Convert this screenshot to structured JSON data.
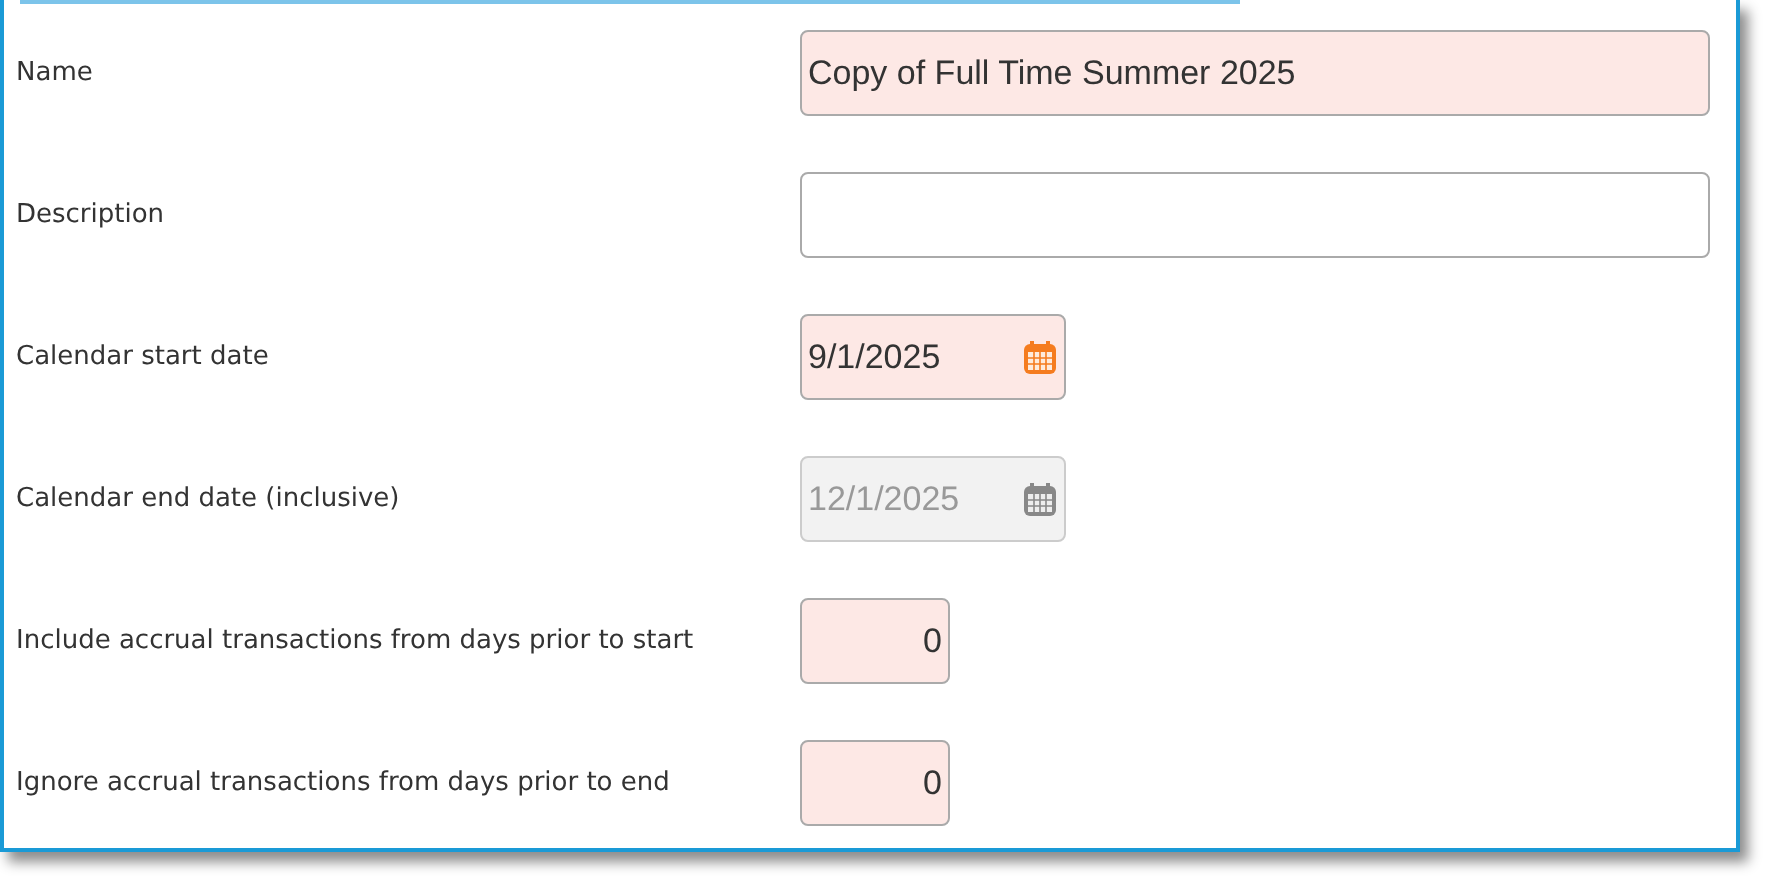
{
  "fields": [
    {
      "label": "Name",
      "kind": "text",
      "value": "Copy of Full Time Summer 2025",
      "required": true,
      "disabled": false
    },
    {
      "label": "Description",
      "kind": "text",
      "required": false,
      "disabled": false
    },
    {
      "label": "Calendar start date",
      "kind": "date",
      "value": "9/1/2025",
      "required": true,
      "disabled": false
    },
    {
      "label": "Calendar end date (inclusive)",
      "kind": "date",
      "value": "12/1/2025",
      "disabled": true
    },
    {
      "label": "Include accrual transactions from days prior to start",
      "kind": "number",
      "value": "0",
      "required": true,
      "disabled": false
    },
    {
      "label": "Ignore accrual transactions from days prior to end",
      "kind": "number",
      "value": "0",
      "required": true,
      "disabled": false
    }
  ]
}
